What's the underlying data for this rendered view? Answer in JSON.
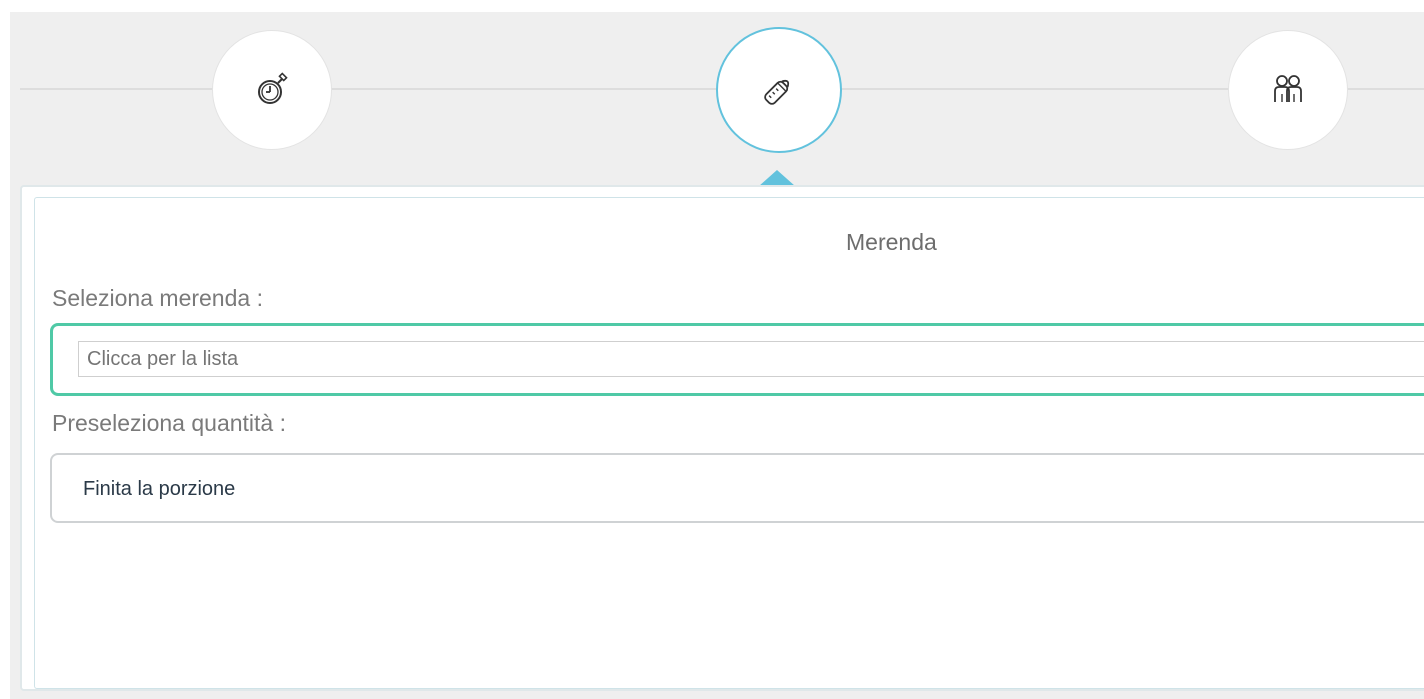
{
  "steps": [
    {
      "name": "stopwatch",
      "icon": "stopwatch-icon",
      "active": false
    },
    {
      "name": "bottle",
      "icon": "baby-bottle-icon",
      "active": true
    },
    {
      "name": "people",
      "icon": "children-icon",
      "active": false
    }
  ],
  "colors": {
    "accent": "#62c2dd",
    "focus_border": "#4fc9a6",
    "background": "#efefef"
  },
  "panel": {
    "title": "Merenda",
    "select_label": "Seleziona merenda :",
    "select_placeholder": "Clicca per la lista",
    "quantity_label": "Preseleziona quantità :",
    "quantity_value": "Finita la porzione"
  }
}
